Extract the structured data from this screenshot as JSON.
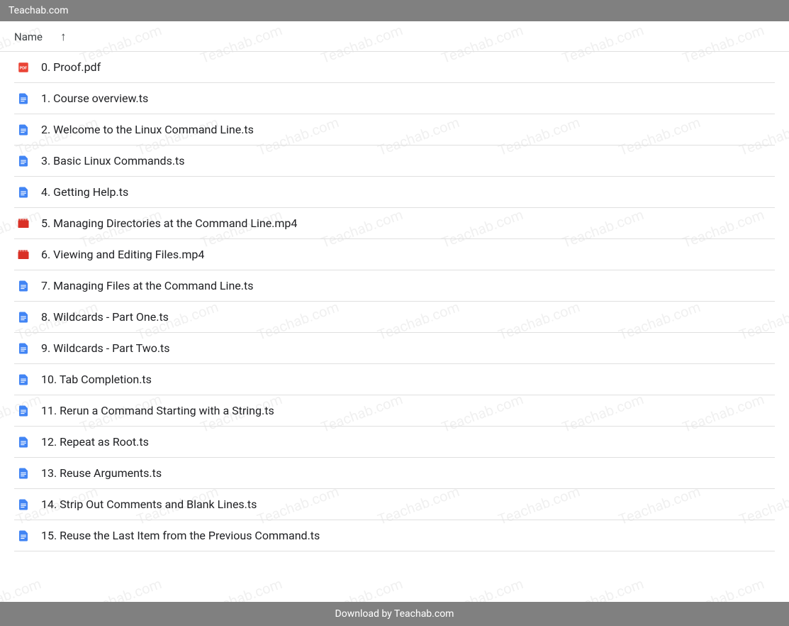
{
  "header": {
    "title": "Teachab.com"
  },
  "columns": {
    "name_label": "Name"
  },
  "files": [
    {
      "name": "0. Proof.pdf",
      "type": "pdf"
    },
    {
      "name": "1. Course overview.ts",
      "type": "doc"
    },
    {
      "name": "2. Welcome to the Linux Command Line.ts",
      "type": "doc"
    },
    {
      "name": "3. Basic Linux Commands.ts",
      "type": "doc"
    },
    {
      "name": "4. Getting Help.ts",
      "type": "doc"
    },
    {
      "name": "5. Managing Directories at the Command Line.mp4",
      "type": "video"
    },
    {
      "name": "6. Viewing and Editing Files.mp4",
      "type": "video"
    },
    {
      "name": "7. Managing Files at the Command Line.ts",
      "type": "doc"
    },
    {
      "name": "8. Wildcards - Part One.ts",
      "type": "doc"
    },
    {
      "name": "9. Wildcards - Part Two.ts",
      "type": "doc"
    },
    {
      "name": "10. Tab Completion.ts",
      "type": "doc"
    },
    {
      "name": "11. Rerun a Command Starting with a String.ts",
      "type": "doc"
    },
    {
      "name": "12. Repeat as Root.ts",
      "type": "doc"
    },
    {
      "name": "13. Reuse Arguments.ts",
      "type": "doc"
    },
    {
      "name": "14. Strip Out Comments and Blank Lines.ts",
      "type": "doc"
    },
    {
      "name": "15. Reuse the Last Item from the Previous Command.ts",
      "type": "doc"
    }
  ],
  "footer": {
    "text": "Download by Teachab.com"
  },
  "watermark": {
    "text": "Teachab.com"
  }
}
